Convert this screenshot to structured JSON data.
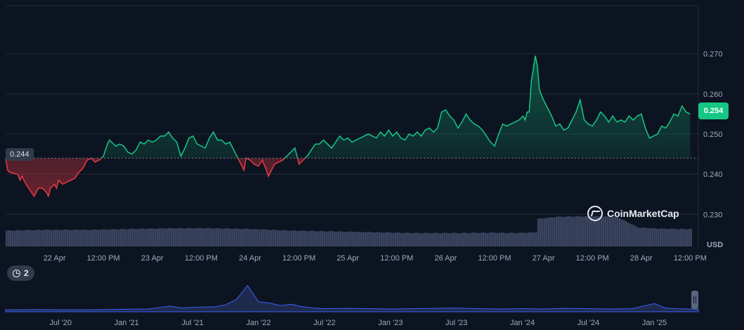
{
  "chart_data": [
    {
      "type": "line",
      "title": "",
      "currency_label": "USD",
      "open_value": 0.244,
      "open_label": "0.244",
      "current_label": "0.254",
      "y_ticks": [
        "0.230",
        "0.240",
        "0.250",
        "0.260",
        "0.270"
      ],
      "y_tick_values": [
        0.23,
        0.24,
        0.25,
        0.26,
        0.27
      ],
      "ylim": [
        0.222,
        0.282
      ],
      "x_ticks": [
        "22 Apr",
        "12:00 PM",
        "23 Apr",
        "12:00 PM",
        "24 Apr",
        "12:00 PM",
        "25 Apr",
        "12:00 PM",
        "26 Apr",
        "12:00 PM",
        "27 Apr",
        "12:00 PM",
        "28 Apr",
        "12:00 PM"
      ],
      "x_tick_hours": [
        12,
        24,
        36,
        48,
        60,
        72,
        84,
        96,
        108,
        120,
        132,
        144,
        156,
        168
      ],
      "xlim_hours": [
        0,
        170
      ],
      "x_unit": "hours since 21 Apr 12:00 AM",
      "price_series": {
        "hours": [
          0,
          0.5,
          1,
          2,
          3,
          3.5,
          4,
          5,
          6,
          7,
          7.5,
          8,
          9,
          10,
          10.5,
          11,
          12,
          12.5,
          13,
          14,
          15,
          16,
          17,
          18,
          19,
          20,
          21,
          22,
          22.7,
          23,
          24,
          25,
          25.5,
          26,
          27,
          28,
          29,
          30,
          31,
          32,
          33,
          34,
          35,
          36,
          37,
          38,
          39,
          40,
          41,
          42,
          43,
          44,
          45,
          46,
          47,
          48,
          49,
          50,
          51,
          52,
          53,
          54,
          55,
          56,
          57,
          58,
          58.5,
          59,
          60,
          61,
          62,
          63,
          64,
          64.5,
          65,
          66,
          67,
          68,
          69,
          70,
          71,
          71.5,
          72,
          73,
          74,
          75,
          76,
          77,
          78,
          79,
          80,
          81,
          82,
          83,
          84,
          85,
          86,
          87,
          88,
          89,
          90,
          91,
          92,
          93,
          94,
          95,
          96,
          97,
          98,
          99,
          100,
          101,
          102,
          103,
          104,
          105,
          106,
          107,
          108,
          109,
          110,
          111,
          112,
          113,
          114,
          115,
          116,
          117,
          118,
          119,
          120,
          121,
          122,
          123,
          124,
          125,
          126,
          127,
          127.5,
          128,
          128.5,
          129,
          130,
          130.5,
          131,
          132,
          133,
          134,
          135,
          136,
          137,
          138,
          139,
          140,
          141,
          142,
          143,
          144,
          145,
          146,
          147,
          148,
          149,
          150,
          151,
          152,
          153,
          154,
          155,
          156,
          157,
          158,
          159,
          160,
          161,
          162,
          163,
          164,
          165,
          166,
          167,
          168
        ],
        "values": [
          0.244,
          0.241,
          0.2405,
          0.2402,
          0.24,
          0.2385,
          0.2395,
          0.2375,
          0.236,
          0.2345,
          0.2355,
          0.2365,
          0.2365,
          0.2355,
          0.2345,
          0.2365,
          0.2375,
          0.2365,
          0.2385,
          0.2375,
          0.238,
          0.2385,
          0.239,
          0.2405,
          0.2415,
          0.2435,
          0.244,
          0.243,
          0.2435,
          0.2435,
          0.2445,
          0.2475,
          0.2485,
          0.248,
          0.247,
          0.2475,
          0.247,
          0.2455,
          0.245,
          0.246,
          0.248,
          0.2475,
          0.2485,
          0.248,
          0.2485,
          0.2495,
          0.2495,
          0.2505,
          0.249,
          0.248,
          0.2445,
          0.2465,
          0.249,
          0.2495,
          0.2475,
          0.247,
          0.2465,
          0.249,
          0.2505,
          0.2485,
          0.2485,
          0.2475,
          0.248,
          0.246,
          0.244,
          0.242,
          0.241,
          0.244,
          0.2435,
          0.2425,
          0.242,
          0.2435,
          0.241,
          0.2395,
          0.2405,
          0.2425,
          0.243,
          0.2435,
          0.2445,
          0.2455,
          0.2465,
          0.2445,
          0.2425,
          0.2435,
          0.2445,
          0.246,
          0.2475,
          0.2475,
          0.2485,
          0.2475,
          0.2465,
          0.248,
          0.2495,
          0.2485,
          0.249,
          0.248,
          0.2485,
          0.249,
          0.2495,
          0.25,
          0.2495,
          0.249,
          0.2505,
          0.2495,
          0.251,
          0.2495,
          0.2505,
          0.249,
          0.2485,
          0.25,
          0.2495,
          0.2505,
          0.2495,
          0.251,
          0.2515,
          0.2505,
          0.2515,
          0.2555,
          0.256,
          0.2545,
          0.2535,
          0.2515,
          0.253,
          0.255,
          0.2535,
          0.2525,
          0.252,
          0.251,
          0.2495,
          0.248,
          0.247,
          0.25,
          0.2525,
          0.252,
          0.2525,
          0.253,
          0.2535,
          0.2545,
          0.2535,
          0.2555,
          0.2555,
          0.263,
          0.2695,
          0.267,
          0.261,
          0.2585,
          0.2565,
          0.2545,
          0.252,
          0.2525,
          0.251,
          0.2515,
          0.2535,
          0.2555,
          0.2585,
          0.2535,
          0.2525,
          0.252,
          0.2535,
          0.2555,
          0.2545,
          0.253,
          0.2545,
          0.253,
          0.2535,
          0.253,
          0.2545,
          0.2535,
          0.2545,
          0.255,
          0.2515,
          0.249,
          0.2495,
          0.25,
          0.252,
          0.2515,
          0.253,
          0.255,
          0.2545,
          0.257,
          0.2555,
          0.255,
          0.2535,
          0.2535
        ]
      },
      "volume_note": "volume in arbitrary relative units (no scale printed)",
      "volume_series": {
        "hours": [
          0,
          10,
          20,
          30,
          40,
          50,
          60,
          70,
          80,
          90,
          100,
          110,
          120,
          125,
          130,
          131,
          135,
          140,
          145,
          150,
          155,
          160,
          165,
          168
        ],
        "values": [
          40,
          42,
          42,
          44,
          46,
          46,
          44,
          40,
          38,
          36,
          34,
          34,
          35,
          34,
          36,
          70,
          75,
          76,
          76,
          74,
          48,
          45,
          44,
          44
        ]
      },
      "up_color": "#16c784",
      "down_color": "#ea3943",
      "volume_color": "#3b4560"
    },
    {
      "type": "area",
      "name": "history-navigator",
      "x_ticks": [
        "Jul '20",
        "Jan '21",
        "Jul '21",
        "Jan '22",
        "Jul '22",
        "Jan '23",
        "Jul '23",
        "Jan '24",
        "Jul '24",
        "Jan '25"
      ],
      "x_tick_months": [
        6,
        12,
        18,
        24,
        30,
        36,
        42,
        48,
        54,
        60
      ],
      "xlim_months": [
        1,
        64
      ],
      "x_unit": "months since Jan 2020",
      "series": {
        "months": [
          1,
          4,
          7,
          10,
          12,
          14,
          16,
          17,
          18,
          20,
          21,
          22,
          23,
          24,
          25,
          26,
          27,
          28,
          29,
          30,
          32,
          34,
          36,
          38,
          40,
          42,
          44,
          46,
          48,
          50,
          52,
          54,
          56,
          58,
          59,
          60,
          61,
          62,
          63,
          64
        ],
        "values": [
          0.3,
          0.35,
          0.3,
          0.35,
          0.4,
          0.45,
          0.9,
          0.6,
          0.7,
          0.8,
          1.1,
          2.0,
          4.2,
          1.6,
          1.4,
          1.0,
          1.2,
          0.8,
          0.6,
          0.5,
          0.55,
          0.5,
          0.45,
          0.5,
          0.55,
          0.6,
          0.5,
          0.45,
          0.5,
          0.45,
          0.55,
          0.5,
          0.45,
          0.5,
          0.9,
          1.3,
          0.6,
          0.5,
          0.45,
          0.4
        ]
      },
      "badge_count": "2"
    }
  ]
}
